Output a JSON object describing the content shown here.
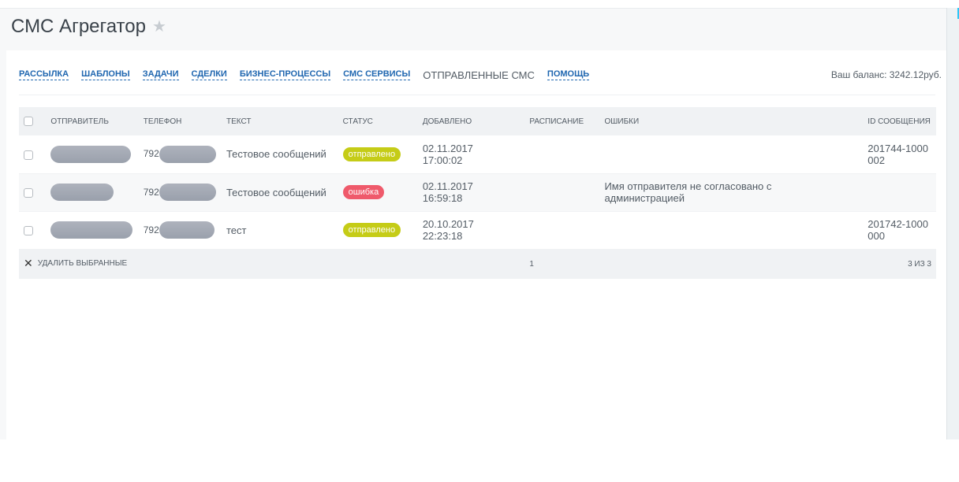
{
  "header": {
    "title": "СМС Агрегатор",
    "star_icon": "star-icon"
  },
  "nav": {
    "links": [
      "РАССЫЛКА",
      "ШАБЛОНЫ",
      "ЗАДАЧИ",
      "СДЕЛКИ",
      "БИЗНЕС-ПРОЦЕССЫ",
      "СМС СЕРВИСЫ"
    ],
    "active": "ОТПРАВЛЕННЫЕ СМС",
    "help": "ПОМОЩЬ",
    "balance": "Ваш баланс: 3242.12руб."
  },
  "table": {
    "columns": [
      "ОТПРАВИТЕЛЬ",
      "ТЕЛЕФОН",
      "ТЕКСТ",
      "СТАТУС",
      "ДОБАВЛЕНО",
      "РАСПИСАНИЕ",
      "ОШИБКИ",
      "ID СООБЩЕНИЯ"
    ],
    "rows": [
      {
        "phone_prefix": "792",
        "text": "Тестовое сообщений",
        "status": "отправлено",
        "date": "02.11.2017",
        "time": "17:00:02",
        "error": "",
        "id": "201744-1000002"
      },
      {
        "phone_prefix": "792",
        "text": "Тестовое сообщений",
        "status": "ошибка",
        "date": "02.11.2017",
        "time": "16:59:18",
        "error": "Имя отправителя не согласовано с администрацией",
        "id": ""
      },
      {
        "phone_prefix": "792",
        "text": "тест",
        "status": "отправлено",
        "date": "20.10.2017",
        "time": "22:23:18",
        "error": "",
        "id": "201742-1000000"
      }
    ],
    "footer": {
      "delete_label": "УДАЛИТЬ ВЫБРАННЫЕ",
      "page": "1",
      "count": "3 ИЗ 3"
    }
  },
  "colors": {
    "link": "#2067b0",
    "status_ok": "#c5cc17",
    "status_err": "#ef5a6b",
    "accent": "#2fc6f6"
  }
}
